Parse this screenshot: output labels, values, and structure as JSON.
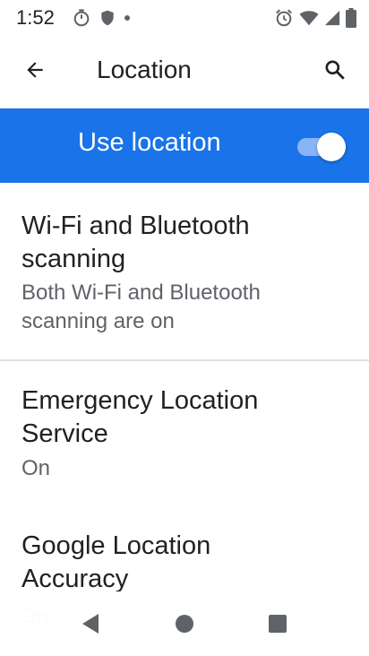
{
  "status_bar": {
    "time": "1:52",
    "left_icons": [
      "stopwatch-icon",
      "shield-icon",
      "dot-icon"
    ],
    "right_icons": [
      "alarm-icon",
      "wifi-icon",
      "signal-icon",
      "battery-icon"
    ]
  },
  "app_bar": {
    "back_icon": "arrow-back-icon",
    "title": "Location",
    "search_icon": "search-icon"
  },
  "use_location": {
    "label": "Use location",
    "enabled": true,
    "accent_color": "#1a73e8"
  },
  "settings": [
    {
      "title_line1": "Wi-Fi and Bluetooth",
      "title_line2": "scanning",
      "subtitle_line1": "Both Wi-Fi and Bluetooth",
      "subtitle_line2": "scanning are on"
    },
    {
      "title_line1": "Emergency Location",
      "title_line2": "Service",
      "subtitle_line1": "On"
    },
    {
      "title_line1": "Google Location",
      "title_line2": "Accuracy",
      "subtitle_line1": "On"
    }
  ],
  "nav_bar": {
    "buttons": [
      "back-triangle-icon",
      "home-circle-icon",
      "recents-square-icon"
    ]
  }
}
